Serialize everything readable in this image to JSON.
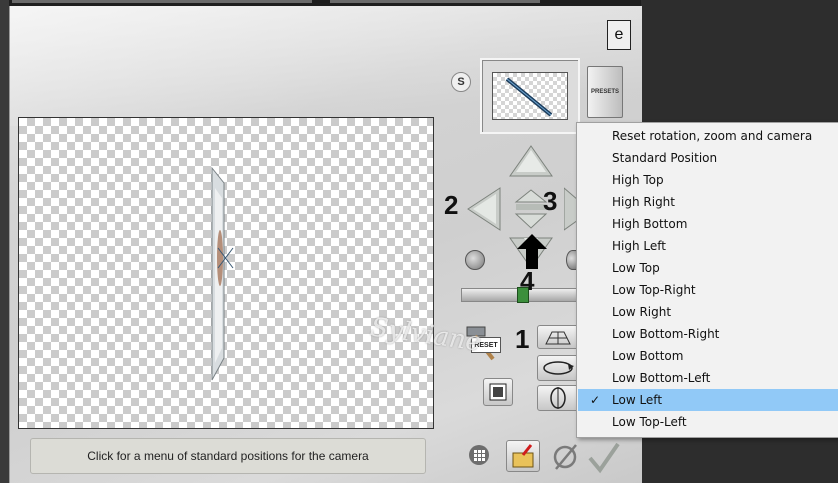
{
  "status_bar": {
    "text": "Click for a menu of standard positions for the camera"
  },
  "toolbar": {
    "presets_label": "PRESETS",
    "s_label": "S",
    "reset_label": "RESET",
    "logo_glyph": "e"
  },
  "annotations": {
    "n1": "1",
    "n2": "2",
    "n3": "3",
    "n4": "4"
  },
  "watermark": {
    "text": "Sylviane"
  },
  "camera_menu": {
    "items": [
      {
        "label": "Reset rotation, zoom and camera",
        "selected": false
      },
      {
        "label": "Standard Position",
        "selected": false
      },
      {
        "label": "High Top",
        "selected": false
      },
      {
        "label": "High Right",
        "selected": false
      },
      {
        "label": "High Bottom",
        "selected": false
      },
      {
        "label": "High Left",
        "selected": false
      },
      {
        "label": "Low Top",
        "selected": false
      },
      {
        "label": "Low Top-Right",
        "selected": false
      },
      {
        "label": "Low Right",
        "selected": false
      },
      {
        "label": "Low Bottom-Right",
        "selected": false
      },
      {
        "label": "Low Bottom",
        "selected": false
      },
      {
        "label": "Low Bottom-Left",
        "selected": false
      },
      {
        "label": "Low Left",
        "selected": true
      },
      {
        "label": "Low Top-Left",
        "selected": false
      }
    ],
    "check_glyph": "✓",
    "highlight_color": "#91c9f7"
  }
}
